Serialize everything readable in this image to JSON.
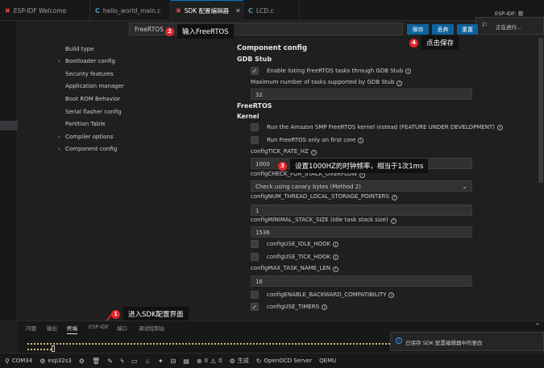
{
  "tabs": [
    {
      "label": "ESP-IDF Welcome",
      "icon": "esp-idf-icon"
    },
    {
      "label": "hello_world_main.c",
      "icon": "c-file-icon",
      "modified": true
    },
    {
      "label": "SDK 配置编辑器",
      "icon": "esp-idf-icon",
      "active": true
    },
    {
      "label": "LCD.c",
      "icon": "c-file-icon"
    }
  ],
  "notification_top": {
    "title": "ESP-IDF: 按",
    "status": "正在进行..."
  },
  "search": {
    "value": "FreeRTOS"
  },
  "buttons": {
    "save": "保存",
    "discard": "丢弃",
    "reset": "重置"
  },
  "callouts": {
    "c1": {
      "num": "1",
      "text": "进入SDK配置界面"
    },
    "c2": {
      "num": "2",
      "text": "输入FreeRTOS"
    },
    "c3": {
      "num": "3",
      "text": "设置1000HZ的时钟频率，相当于1次1ms"
    },
    "c4": {
      "num": "4",
      "text": "点击保存"
    }
  },
  "tree": [
    {
      "label": "Build type",
      "expandable": false
    },
    {
      "label": "Bootloader config",
      "expandable": true
    },
    {
      "label": "Security features",
      "expandable": false
    },
    {
      "label": "Application manager",
      "expandable": false
    },
    {
      "label": "Boot ROM Behavior",
      "expandable": false
    },
    {
      "label": "Serial flasher config",
      "expandable": false
    },
    {
      "label": "Partition Table",
      "expandable": false
    },
    {
      "label": "Compiler options",
      "expandable": true
    },
    {
      "label": "Component config",
      "expandable": true
    }
  ],
  "config": {
    "heading": "Component config",
    "gdb_stub": "GDB Stub",
    "enable_listing": {
      "label": "Enable listing FreeRTOS tasks through GDB Stub",
      "checked": true
    },
    "max_tasks": {
      "label": "Maximum number of tasks supported by GDB Stub",
      "value": "32"
    },
    "freertos": "FreeRTOS",
    "kernel": "Kernel",
    "smp": {
      "label": "Run the Amazon SMP FreeRTOS kernel instead (FEATURE UNDER DEVELOPMENT)",
      "checked": false
    },
    "first_core": {
      "label": "Run FreeRTOS only on first core",
      "checked": false
    },
    "tick_rate": {
      "label": "configTICK_RATE_HZ",
      "value": "1000"
    },
    "stack_overflow": {
      "label": "configCHECK_FOR_STACK_OVERFLOW",
      "value": "Check using canary bytes (Method 2)"
    },
    "tls_pointers": {
      "label": "configNUM_THREAD_LOCAL_STORAGE_POINTERS",
      "value": "1"
    },
    "min_stack": {
      "label": "configMINIMAL_STACK_SIZE (Idle task stack size)",
      "value": "1536"
    },
    "idle_hook": {
      "label": "configUSE_IDLE_HOOK",
      "checked": false
    },
    "tick_hook": {
      "label": "configUSE_TICK_HOOK",
      "checked": false
    },
    "max_task_name": {
      "label": "configMAX_TASK_NAME_LEN",
      "value": "16"
    },
    "backward_compat": {
      "label": "configENABLE_BACKWARD_COMPATIBILITY",
      "checked": false
    },
    "use_timers": {
      "label": "configUSE_TIMERS",
      "checked": true
    }
  },
  "panel_tabs": [
    "问题",
    "输出",
    "终端",
    "ESP-IDF",
    "端口",
    "调试控制台"
  ],
  "panel_active": "终端",
  "notification_bottom": "已保存 SDK 配置编辑器中的更改",
  "status": {
    "port": "COM34",
    "target": "esp32s3",
    "errors": "0",
    "warnings": "0",
    "build": "生成",
    "openocd": "OpenOCD Server",
    "qemu": "QEMU"
  },
  "colors": {
    "accent": "#0e639c",
    "callout_badge": "#e8252a",
    "terminal_dots": "#d7ba7d"
  }
}
